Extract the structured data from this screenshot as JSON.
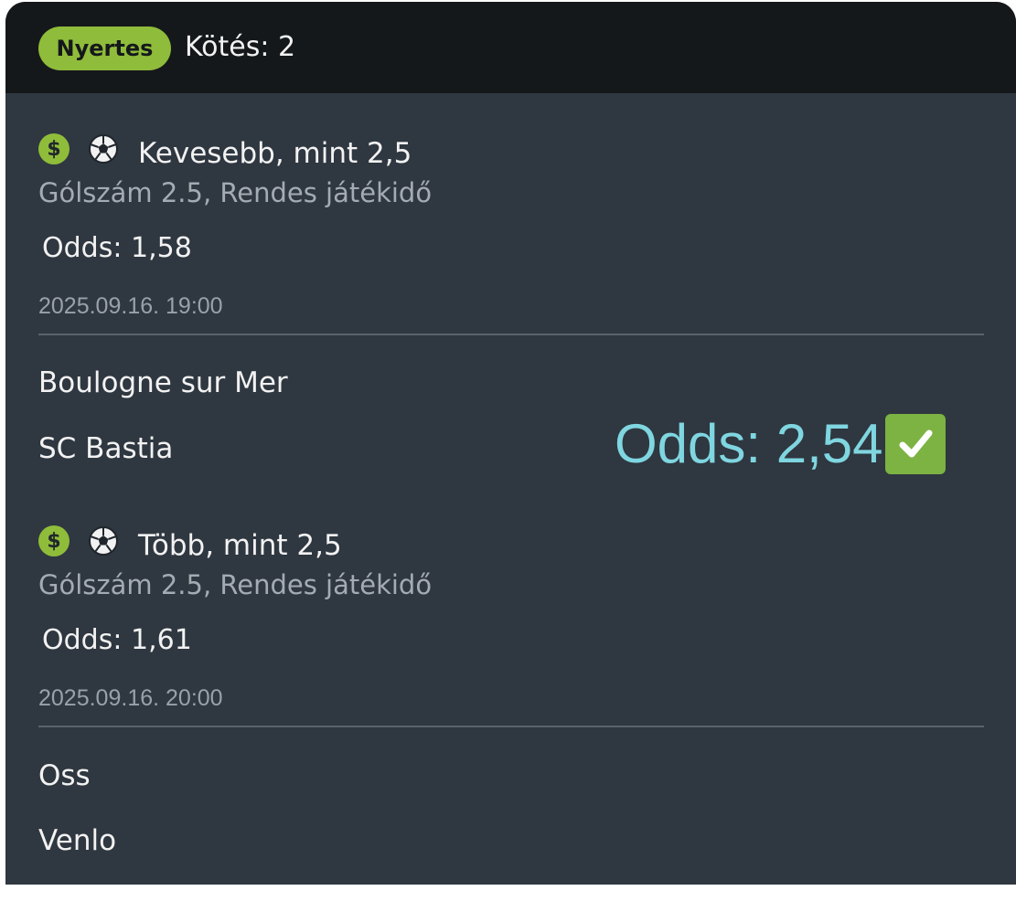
{
  "header": {
    "status_badge": "Nyertes",
    "bet_count": "Kötés: 2"
  },
  "bets": [
    {
      "selection": "Kevesebb, mint 2,5",
      "market": "Gólszám 2.5, Rendes játékidő",
      "odds_label": "Odds:",
      "odds_value": "1,58",
      "datetime": "2025.09.16.  19:00",
      "home_team": "Boulogne sur Mer",
      "away_team": "SC Bastia"
    },
    {
      "selection": "Több, mint 2,5",
      "market": "Gólszám 2.5, Rendes játékidő",
      "odds_label": "Odds:",
      "odds_value": "1,61",
      "datetime": "2025.09.16.  20:00",
      "home_team": "Oss",
      "away_team": "Venlo"
    }
  ],
  "total": {
    "odds_text": "Odds: 2,54"
  },
  "icons": {
    "money": "dollar-icon",
    "sport": "soccer-ball-icon",
    "won": "checkmark-icon",
    "dollar_glyph": "$"
  },
  "colors": {
    "win_green": "#8fbc3a",
    "odds_cyan": "#7fd6e0",
    "card_bg": "#2f3740",
    "header_bg": "#15181b"
  }
}
